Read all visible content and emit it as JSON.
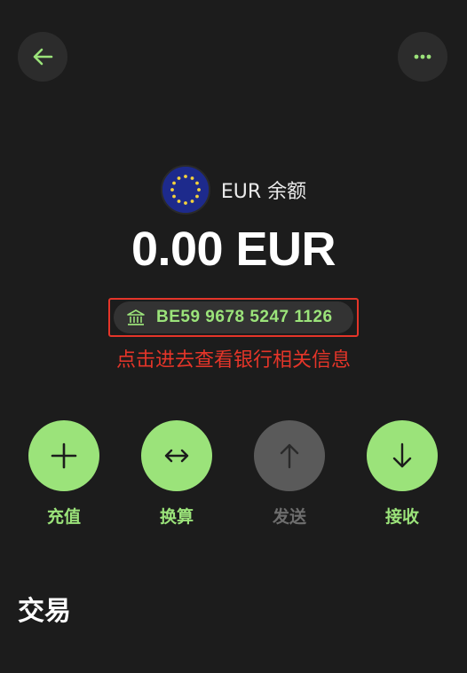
{
  "header": {
    "back_icon": "arrow-left-icon",
    "more_icon": "more-horizontal-icon"
  },
  "account": {
    "flag_icon": "eu-flag-icon",
    "currency_label": "EUR 余额",
    "balance": "0.00 EUR",
    "bank_icon": "bank-icon",
    "iban": "BE59 9678 5247 1126",
    "hint": "点击进去查看银行相关信息"
  },
  "actions": [
    {
      "label": "充值",
      "icon": "plus-icon",
      "enabled": true
    },
    {
      "label": "换算",
      "icon": "swap-horizontal-icon",
      "enabled": true
    },
    {
      "label": "发送",
      "icon": "arrow-up-icon",
      "enabled": false
    },
    {
      "label": "接收",
      "icon": "arrow-down-icon",
      "enabled": true
    }
  ],
  "transactions": {
    "title": "交易"
  },
  "colors": {
    "background": "#1c1c1c",
    "accent": "#9be37a",
    "annotation_red": "#e53529",
    "disabled": "#5a5a5a"
  }
}
